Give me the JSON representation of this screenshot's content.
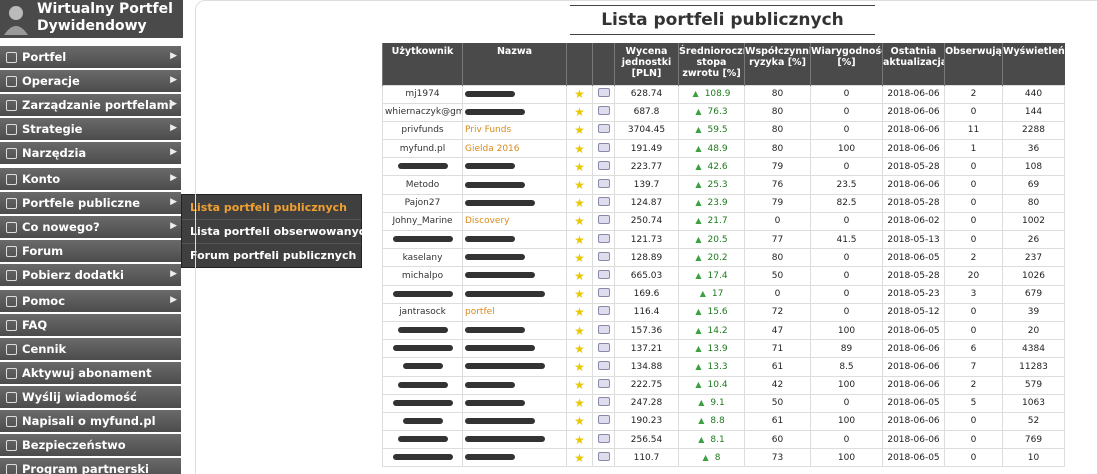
{
  "brand": {
    "line1": "Wirtualny Portfel",
    "line2": "Dywidendowy"
  },
  "menu": [
    {
      "label": "Portfel",
      "icon": "briefcase-icon",
      "arrow": true
    },
    {
      "label": "Operacje",
      "icon": "document-icon",
      "arrow": true
    },
    {
      "label": "Zarządzanie portfelami",
      "icon": "gear-icon",
      "arrow": true
    },
    {
      "label": "Strategie",
      "icon": "chart-icon",
      "arrow": true
    },
    {
      "label": "Narzędzia",
      "icon": "calendar-icon",
      "arrow": true
    },
    {
      "label": "Konto",
      "icon": "user-icon",
      "arrow": true,
      "gap": true
    },
    {
      "label": "Portfele publiczne",
      "icon": "globe-icon",
      "arrow": true
    },
    {
      "label": "Co nowego?",
      "icon": "question-icon",
      "arrow": true
    },
    {
      "label": "Forum",
      "icon": "chat-icon",
      "arrow": false
    },
    {
      "label": "Pobierz dodatki",
      "icon": "download-icon",
      "arrow": true
    },
    {
      "label": "Pomoc",
      "icon": "help-icon",
      "arrow": true,
      "gap": true
    },
    {
      "label": "FAQ",
      "icon": "info-icon",
      "arrow": false
    },
    {
      "label": "Cennik",
      "icon": "price-icon",
      "arrow": false
    },
    {
      "label": "Aktywuj abonament",
      "icon": "key-icon",
      "arrow": false
    },
    {
      "label": "Wyślij wiadomość",
      "icon": "mail-icon",
      "arrow": false
    },
    {
      "label": "Napisali o myfund.pl",
      "icon": "pen-icon",
      "arrow": false
    },
    {
      "label": "Bezpieczeństwo",
      "icon": "lock-icon",
      "arrow": false
    },
    {
      "label": "Program partnerski",
      "icon": "partner-icon",
      "arrow": false
    }
  ],
  "submenu": [
    {
      "label": "Lista portfeli publicznych",
      "active": true
    },
    {
      "label": "Lista portfeli obserwowanych",
      "active": false
    },
    {
      "label": "Forum portfeli publicznych",
      "active": false
    }
  ],
  "page_title": "Lista portfeli publicznych",
  "table": {
    "headers": [
      "Użytkownik",
      "Nazwa",
      "",
      "",
      "Wycena jednostki [PLN]",
      "Średnioroczna stopa zwrotu [%]",
      "Współczynnik ryzyka [%]",
      "Wiarygodność [%]",
      "Ostatnia aktualizacja",
      "Obserwują",
      "Wyświetleń"
    ],
    "rows": [
      [
        "mj1974",
        "",
        "628.74",
        "108.9",
        "80",
        "0",
        "2018-06-06",
        "2",
        "440"
      ],
      [
        "whiernaczyk@gma",
        "",
        "687.8",
        "76.3",
        "80",
        "0",
        "2018-06-06",
        "0",
        "144"
      ],
      [
        "privfunds",
        "Priv Funds",
        "3704.45",
        "59.5",
        "80",
        "0",
        "2018-06-06",
        "11",
        "2288"
      ],
      [
        "myfund.pl",
        "Gielda 2016",
        "191.49",
        "48.9",
        "80",
        "100",
        "2018-06-06",
        "1",
        "36"
      ],
      [
        "",
        "",
        "223.77",
        "42.6",
        "79",
        "0",
        "2018-05-28",
        "0",
        "108"
      ],
      [
        "Metodo",
        "",
        "139.7",
        "25.3",
        "76",
        "23.5",
        "2018-06-06",
        "0",
        "69"
      ],
      [
        "Pajon27",
        "",
        "124.87",
        "23.9",
        "79",
        "82.5",
        "2018-05-28",
        "0",
        "80"
      ],
      [
        "Johny_Marine",
        "Discovery",
        "250.74",
        "21.7",
        "0",
        "0",
        "2018-06-02",
        "0",
        "1002"
      ],
      [
        "",
        "",
        "121.73",
        "20.5",
        "77",
        "41.5",
        "2018-05-13",
        "0",
        "26"
      ],
      [
        "kaselany",
        "",
        "128.89",
        "20.2",
        "80",
        "0",
        "2018-06-05",
        "2",
        "237"
      ],
      [
        "michalpo",
        "",
        "665.03",
        "17.4",
        "50",
        "0",
        "2018-05-28",
        "20",
        "1026"
      ],
      [
        "",
        "",
        "169.6",
        "17",
        "0",
        "0",
        "2018-05-23",
        "3",
        "679"
      ],
      [
        "jantrasock",
        "portfel",
        "116.4",
        "15.6",
        "72",
        "0",
        "2018-05-12",
        "0",
        "39"
      ],
      [
        "",
        "",
        "157.36",
        "14.2",
        "47",
        "100",
        "2018-06-05",
        "0",
        "20"
      ],
      [
        "",
        "",
        "137.21",
        "13.9",
        "71",
        "89",
        "2018-06-06",
        "6",
        "4384"
      ],
      [
        "",
        "",
        "134.88",
        "13.3",
        "61",
        "8.5",
        "2018-06-06",
        "7",
        "11283"
      ],
      [
        "",
        "",
        "222.75",
        "10.4",
        "42",
        "100",
        "2018-06-06",
        "2",
        "579"
      ],
      [
        "",
        "",
        "247.28",
        "9.1",
        "50",
        "0",
        "2018-06-05",
        "5",
        "1063"
      ],
      [
        "",
        "",
        "190.23",
        "8.8",
        "61",
        "100",
        "2018-06-06",
        "0",
        "52"
      ],
      [
        "",
        "",
        "256.54",
        "8.1",
        "60",
        "0",
        "2018-06-06",
        "0",
        "769"
      ],
      [
        "",
        "",
        "110.7",
        "8",
        "73",
        "100",
        "2018-06-05",
        "0",
        "10"
      ]
    ]
  }
}
